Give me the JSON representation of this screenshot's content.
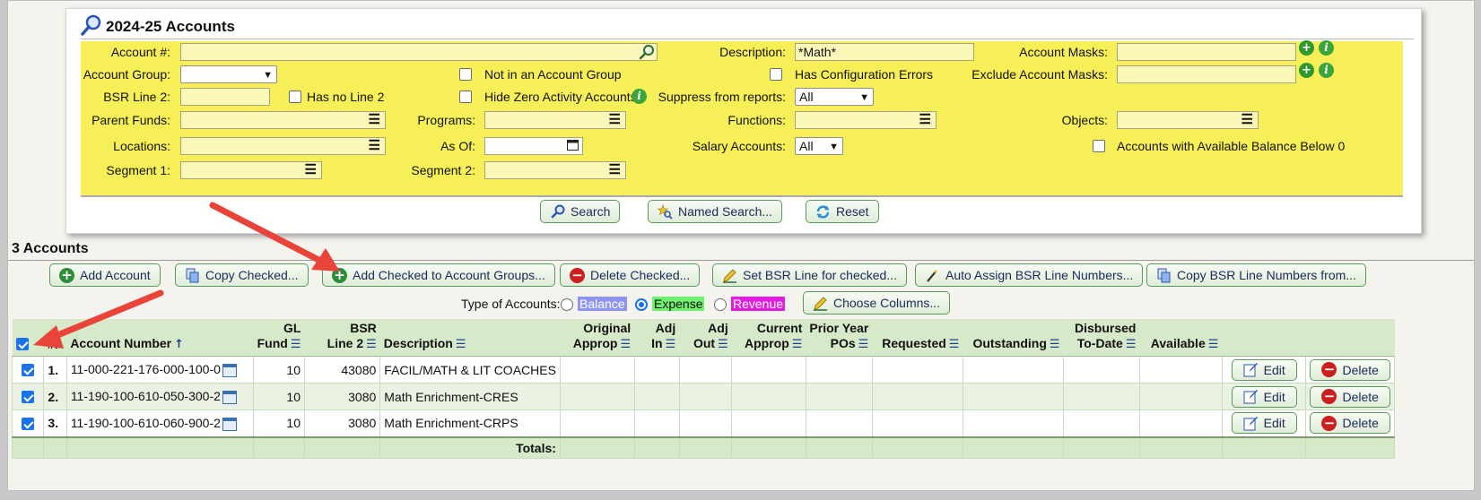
{
  "panel": {
    "title": "2024-25 Accounts",
    "fields": {
      "account_num_label": "Account #:",
      "account_num_value": "",
      "description_label": "Description:",
      "description_value": "*Math*",
      "account_masks_label": "Account Masks:",
      "account_group_label": "Account Group:",
      "not_in_group_label": "Not in an Account Group",
      "has_config_errors_label": "Has Configuration Errors",
      "exclude_masks_label": "Exclude Account Masks:",
      "bsr_line2_label": "BSR Line 2:",
      "has_no_line2_label": "Has no Line 2",
      "hide_zero_label": "Hide Zero Activity Accounts",
      "suppress_label": "Suppress from reports:",
      "suppress_value": "All",
      "parent_funds_label": "Parent Funds:",
      "programs_label": "Programs:",
      "functions_label": "Functions:",
      "objects_label": "Objects:",
      "locations_label": "Locations:",
      "as_of_label": "As Of:",
      "salary_label": "Salary Accounts:",
      "salary_value": "All",
      "below_zero_label": "Accounts with Available Balance Below 0",
      "segment1_label": "Segment 1:",
      "segment2_label": "Segment 2:"
    },
    "buttons": {
      "search": "Search",
      "named_search": "Named Search...",
      "reset": "Reset"
    }
  },
  "results": {
    "title": "3 Accounts",
    "toolbar": {
      "add_account": "Add Account",
      "copy_checked": "Copy Checked...",
      "add_to_groups": "Add Checked to Account Groups...",
      "delete_checked": "Delete Checked...",
      "set_bsr": "Set BSR Line for checked...",
      "auto_assign": "Auto Assign BSR Line Numbers...",
      "copy_bsr": "Copy BSR Line Numbers from..."
    },
    "type_label": "Type of Accounts:",
    "types": [
      "Balance",
      "Expense",
      "Revenue"
    ],
    "type_selected": "Expense",
    "type_colors": {
      "Balance": "#8f94f2",
      "Expense": "#6ff06f",
      "Revenue": "#e31ee3"
    },
    "choose_columns": "Choose Columns...",
    "columns": {
      "num": "#.",
      "account_number": "Account Number",
      "gl_fund_1": "GL",
      "gl_fund_2": "Fund",
      "bsr_1": "BSR",
      "bsr_2": "Line 2",
      "description": "Description",
      "orig_1": "Original",
      "orig_2": "Approp",
      "adjin_1": "Adj",
      "adjin_2": "In",
      "adjout_1": "Adj",
      "adjout_2": "Out",
      "curr_1": "Current",
      "curr_2": "Approp",
      "prior_1": "Prior Year",
      "prior_2": "POs",
      "requested": "Requested",
      "outstanding": "Outstanding",
      "disb_1": "Disbursed",
      "disb_2": "To-Date",
      "available": "Available"
    },
    "rows": [
      {
        "num": "1.",
        "account": "11-000-221-176-000-100-0",
        "fund": "10",
        "bsr": "43080",
        "description": "FACIL/MATH & LIT COACHES"
      },
      {
        "num": "2.",
        "account": "11-190-100-610-050-300-2",
        "fund": "10",
        "bsr": "3080",
        "description": "Math Enrichment-CRES"
      },
      {
        "num": "3.",
        "account": "11-190-100-610-060-900-2",
        "fund": "10",
        "bsr": "3080",
        "description": "Math Enrichment-CRPS"
      }
    ],
    "row_edit": "Edit",
    "row_delete": "Delete",
    "totals_label": "Totals:"
  },
  "colors": {
    "criteria_bg": "#f7ef57",
    "header_bg": "#d6e9c8",
    "arrow": "#e8443a"
  }
}
